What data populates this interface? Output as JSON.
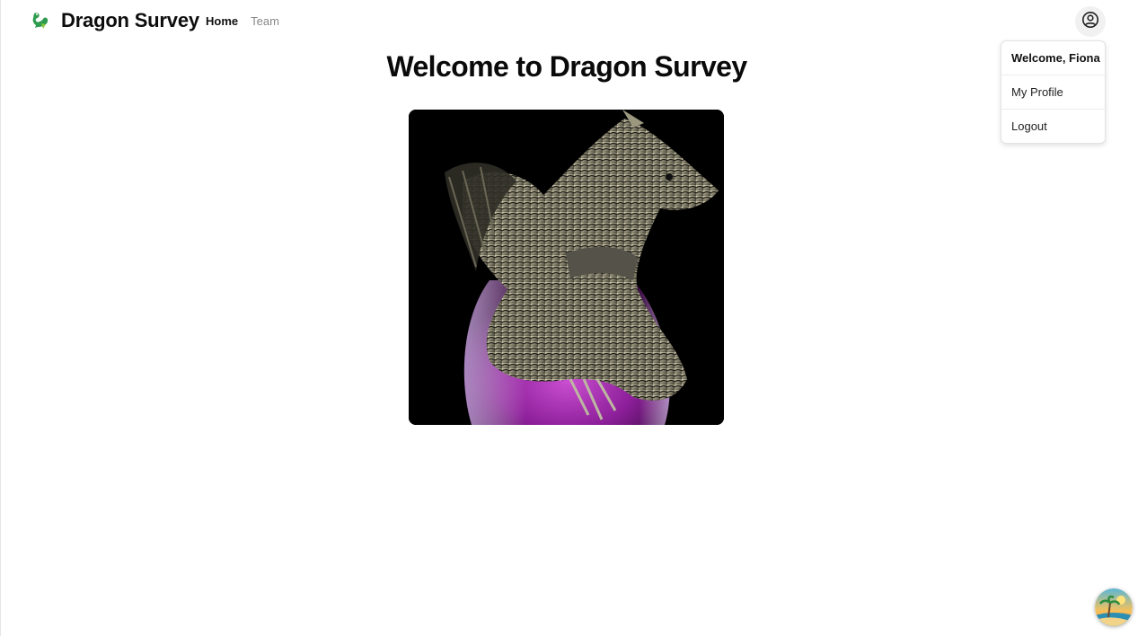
{
  "brand": {
    "name": "Dragon Survey",
    "logo_icon": "dragon-logo-icon"
  },
  "nav": {
    "items": [
      {
        "label": "Home",
        "active": true
      },
      {
        "label": "Team",
        "active": false
      }
    ]
  },
  "user_menu": {
    "icon": "user-circle-icon",
    "welcome": "Welcome, Fiona",
    "items": [
      {
        "label": "My Profile"
      },
      {
        "label": "Logout"
      }
    ]
  },
  "main": {
    "title": "Welcome to Dragon Survey",
    "hero_image": "dragon-on-purple-potion-bottle"
  },
  "floating_avatar": {
    "icon": "beach-palm-avatar-icon"
  },
  "colors": {
    "text": "#111111",
    "muted": "#888888",
    "logo_green": "#2e9b4f",
    "potion_purple": "#9b2aa8"
  }
}
